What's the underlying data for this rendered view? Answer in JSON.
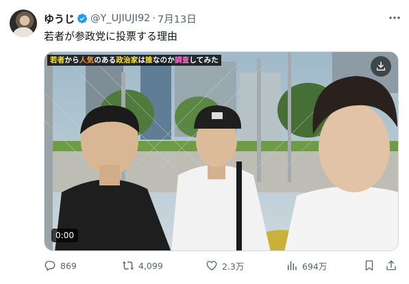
{
  "user": {
    "display_name": "ゆうじ",
    "handle": "@Y_UJIUJI92",
    "separator": "·",
    "date": "7月13日"
  },
  "tweet": {
    "text": "若者が参政党に投票する理由"
  },
  "media": {
    "caption": {
      "part1": "若者",
      "part2": "から",
      "part3": "人気",
      "part4": "のある",
      "part5": "政治家",
      "part6": "は",
      "part7": "誰",
      "part8": "なのか",
      "part9": "調査",
      "part10": "してみた"
    },
    "timestamp": "0:00",
    "download_icon": "download-icon"
  },
  "actions": {
    "replies": "869",
    "retweets": "4,099",
    "likes": "2.3万",
    "views": "694万"
  },
  "colors": {
    "text_primary": "#0f1419",
    "text_secondary": "#536471",
    "verified_blue": "#1d9bf0",
    "border": "#cfd9de"
  }
}
